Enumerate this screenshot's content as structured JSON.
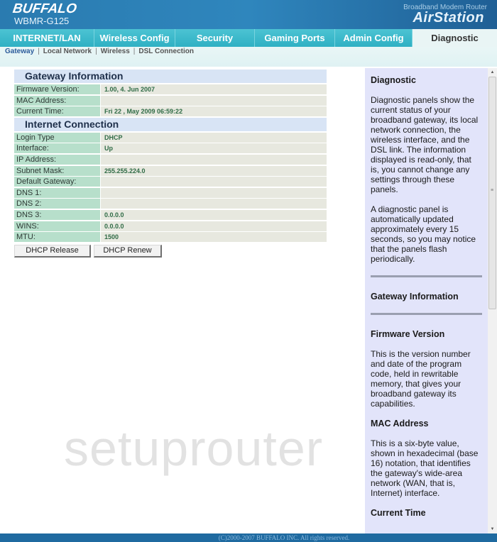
{
  "header": {
    "logo": "BUFFALO",
    "model": "WBMR-G125",
    "tagline": "Broadband Modem Router",
    "brand": "AirStation"
  },
  "tabs": [
    {
      "label": "INTERNET/LAN",
      "active": false
    },
    {
      "label": "Wireless Config",
      "active": false
    },
    {
      "label": "Security",
      "active": false
    },
    {
      "label": "Gaming Ports",
      "active": false
    },
    {
      "label": "Admin Config",
      "active": false
    },
    {
      "label": "Diagnostic",
      "active": true
    }
  ],
  "subnav": [
    {
      "label": "Gateway",
      "active": true
    },
    {
      "label": "Local Network",
      "active": false
    },
    {
      "label": "Wireless",
      "active": false
    },
    {
      "label": "DSL Connection",
      "active": false
    }
  ],
  "gateway": {
    "title": "Gateway Information",
    "rows": [
      {
        "label": "Firmware Version:",
        "value": "1.00, 4. Jun 2007"
      },
      {
        "label": "MAC Address:",
        "value": ""
      },
      {
        "label": "Current Time:",
        "value": "Fri 22 , May 2009 06:59:22"
      }
    ]
  },
  "internet": {
    "title": "Internet Connection",
    "rows": [
      {
        "label": "Login Type",
        "value": "DHCP"
      },
      {
        "label": "Interface:",
        "value": "Up"
      },
      {
        "label": "IP Address:",
        "value": ""
      },
      {
        "label": "Subnet Mask:",
        "value": "255.255.224.0"
      },
      {
        "label": "Default Gateway:",
        "value": ""
      },
      {
        "label": "DNS 1:",
        "value": ""
      },
      {
        "label": "DNS 2:",
        "value": ""
      },
      {
        "label": "DNS 3:",
        "value": "0.0.0.0"
      },
      {
        "label": "WINS:",
        "value": "0.0.0.0"
      },
      {
        "label": "MTU:",
        "value": "1500"
      }
    ]
  },
  "buttons": {
    "release": "DHCP Release",
    "renew": "DHCP Renew"
  },
  "help": {
    "title": "Diagnostic",
    "p1": "Diagnostic panels show the current status of your broadband gateway, its local network connection, the wireless interface, and the DSL link. The information displayed is read-only, that is, you cannot change any settings through these panels.",
    "p2": "A diagnostic panel is automatically updated approximately every 15 seconds, so you may notice that the panels flash periodically.",
    "section": "Gateway Information",
    "firmware_title": "Firmware Version",
    "firmware_text": "This is the version number and date of the program code, held in rewritable memory, that gives your broadband gateway its capabilities.",
    "mac_title": "MAC Address",
    "mac_text": "This is a six-byte value, shown in hexadecimal (base 16) notation, that identifies the gateway's wide-area network (WAN, that is, Internet) interface.",
    "time_title": "Current Time"
  },
  "watermark": "setuprouter",
  "footer": "(C)2000-2007 BUFFALO INC. All rights reserved."
}
